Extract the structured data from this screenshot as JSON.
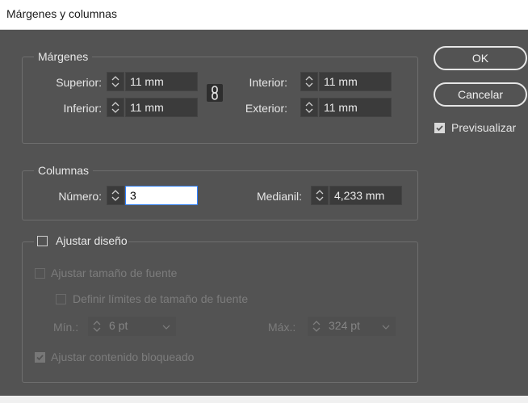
{
  "window": {
    "title": "Márgenes y columnas"
  },
  "margins": {
    "legend": "Márgenes",
    "superior_label": "Superior:",
    "superior_value": "11 mm",
    "inferior_label": "Inferior:",
    "inferior_value": "11 mm",
    "interior_label": "Interior:",
    "interior_value": "11 mm",
    "exterior_label": "Exterior:",
    "exterior_value": "11 mm",
    "link_icon": "link-chain-icon"
  },
  "columns": {
    "legend": "Columnas",
    "numero_label": "Número:",
    "numero_value": "3",
    "medianil_label": "Medianil:",
    "medianil_value": "4,233 mm"
  },
  "adjust": {
    "legend": "Ajustar diseño",
    "checked": false,
    "font_size_label": "Ajustar tamaño de fuente",
    "font_limits_label": "Definir límites de tamaño de fuente",
    "min_label": "Mín.:",
    "min_value": "6 pt",
    "max_label": "Máx.:",
    "max_value": "324 pt",
    "locked_label": "Ajustar contenido bloqueado",
    "locked_checked": true
  },
  "buttons": {
    "ok": "OK",
    "cancel": "Cancelar"
  },
  "preview": {
    "label": "Previsualizar",
    "checked": true
  },
  "colors": {
    "background": "#535353",
    "field": "#3b3b3b",
    "focus": "#2f7fff"
  }
}
